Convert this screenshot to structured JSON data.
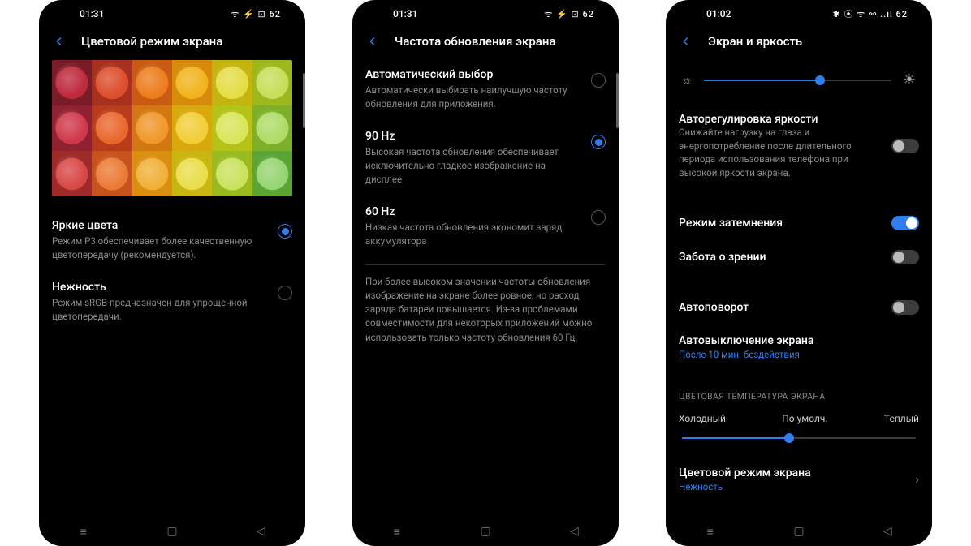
{
  "phones": [
    {
      "status": {
        "time": "01:31",
        "icons": "ᯤ ⚡ ⊡ 62"
      },
      "title": "Цветовой режим экрана",
      "options": [
        {
          "title": "Яркие цвета",
          "desc": "Режим P3 обеспечивает более качественную цветопередачу (рекомендуется).",
          "on": true
        },
        {
          "title": "Нежность",
          "desc": "Режим sRGB предназначен для упрощенной цветопередачи.",
          "on": false
        }
      ]
    },
    {
      "status": {
        "time": "01:31",
        "icons": "ᯤ ⚡ ⊡ 62"
      },
      "title": "Частота обновления экрана",
      "options": [
        {
          "title": "Автоматический выбор",
          "desc": "Автоматически выбирать наилучшую частоту обновления для приложения.",
          "on": false
        },
        {
          "title": "90 Hz",
          "desc": "Высокая частота обновления обеспечивает исключительно гладкое изображение на дисплее",
          "on": true
        },
        {
          "title": "60 Hz",
          "desc": "Низкая частота обновления экономит заряд аккумулятора",
          "on": false
        }
      ],
      "note": "При более высоком значении частоты обновления изображение на экране более ровное, но расход заряда батареи повышается. Из-за проблемами совместимости для некоторых приложений можно использовать только частоту обновления 60 Гц."
    },
    {
      "status": {
        "time": "01:02",
        "icons": "✱ ⦿ ᯤ ⚯ ..ıl 62"
      },
      "title": "Экран и яркость",
      "brightness_pct": 62,
      "rows": {
        "auto_bright": {
          "title": "Авторегулировка яркости",
          "desc": "Снижайте нагрузку на глаза и энергопотребление после длительного периода использования телефона при высокой яркости экрана.",
          "on": false
        },
        "dark": {
          "title": "Режим затемнения",
          "on": true
        },
        "eyecare": {
          "title": "Забота о зрении",
          "on": false
        },
        "autorotate": {
          "title": "Автоповорот",
          "on": false
        },
        "autooff": {
          "title": "Автовыключение экрана",
          "sub": "После 10 мин. бездействия"
        },
        "temp_label": "ЦВЕТОВАЯ ТЕМПЕРАТУРА ЭКРАНА",
        "temp_cold": "Холодный",
        "temp_def": "По умолч.",
        "temp_warm": "Теплый",
        "temp_pct": 46,
        "colormode": {
          "title": "Цветовой режим экрана",
          "sub": "Нежность"
        }
      }
    }
  ]
}
